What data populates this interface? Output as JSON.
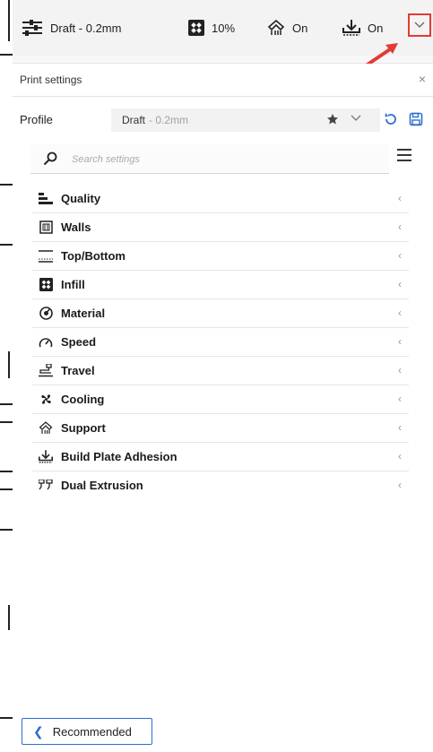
{
  "toolbar": {
    "profile_label": "Draft - 0.2mm",
    "infill_value": "10%",
    "support_value": "On",
    "adhesion_value": "On",
    "accent_color": "#e53935"
  },
  "panel": {
    "title": "Print settings",
    "close_glyph": "×",
    "profile_label": "Profile",
    "profile_name": "Draft",
    "profile_layer": " - 0.2mm",
    "search_placeholder": "Search settings"
  },
  "categories": [
    {
      "label": "Quality",
      "icon": "quality-icon"
    },
    {
      "label": "Walls",
      "icon": "walls-icon"
    },
    {
      "label": "Top/Bottom",
      "icon": "top-bottom-icon"
    },
    {
      "label": "Infill",
      "icon": "infill-icon"
    },
    {
      "label": "Material",
      "icon": "material-icon"
    },
    {
      "label": "Speed",
      "icon": "speed-icon"
    },
    {
      "label": "Travel",
      "icon": "travel-icon"
    },
    {
      "label": "Cooling",
      "icon": "cooling-icon"
    },
    {
      "label": "Support",
      "icon": "support-icon"
    },
    {
      "label": "Build Plate Adhesion",
      "icon": "adhesion-icon"
    },
    {
      "label": "Dual Extrusion",
      "icon": "dual-extrusion-icon"
    }
  ],
  "footer": {
    "recommended_label": "Recommended"
  },
  "colors": {
    "accent_blue": "#2c6fd1",
    "annotation_red": "#e53935"
  }
}
